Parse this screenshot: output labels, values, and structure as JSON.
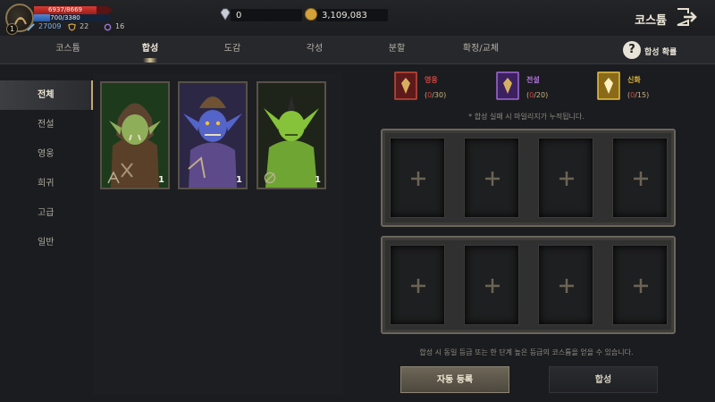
{
  "player": {
    "level": "1",
    "hp_text": "6937/8669",
    "hp_fraction": 0.8,
    "mp_text": "700/3380",
    "mp_fraction": 0.21,
    "stat_power": "27009",
    "stat_defense": "22",
    "stat_magic": "16"
  },
  "currency": {
    "gems": "0",
    "gold": "3,109,083"
  },
  "header": {
    "title": "코스튬"
  },
  "tabs": [
    {
      "label": "코스튬"
    },
    {
      "label": "합성"
    },
    {
      "label": "도감"
    },
    {
      "label": "각성"
    },
    {
      "label": "분할"
    },
    {
      "label": "확정/교체"
    }
  ],
  "active_tab": "합성",
  "help": {
    "icon": "?",
    "label": "합성 확률"
  },
  "categories": [
    {
      "label": "전체"
    },
    {
      "label": "전설"
    },
    {
      "label": "영웅"
    },
    {
      "label": "희귀"
    },
    {
      "label": "고급"
    },
    {
      "label": "일반"
    }
  ],
  "inventory": [
    {
      "count": "1",
      "icon": "orc-warrior-costume"
    },
    {
      "count": "1",
      "icon": "blue-goblin-costume"
    },
    {
      "count": "1",
      "icon": "green-goblin-costume"
    }
  ],
  "grades": [
    {
      "name": "영웅",
      "current": "0",
      "total": "/30",
      "color": "#d6453e"
    },
    {
      "name": "전설",
      "current": "0",
      "total": "/20",
      "color": "#b377e0"
    },
    {
      "name": "신화",
      "current": "0",
      "total": "/15",
      "color": "#e0b63a"
    }
  ],
  "hints": {
    "mileage": "* 합성 실패 시 마일리지가 누적됩니다.",
    "merge_info": "합성 시 동일 등급 또는 한 단계 높은 등급의 코스튬을 얻을 수 있습니다."
  },
  "buttons": {
    "auto_register": "자동 등록",
    "merge": "합성"
  }
}
